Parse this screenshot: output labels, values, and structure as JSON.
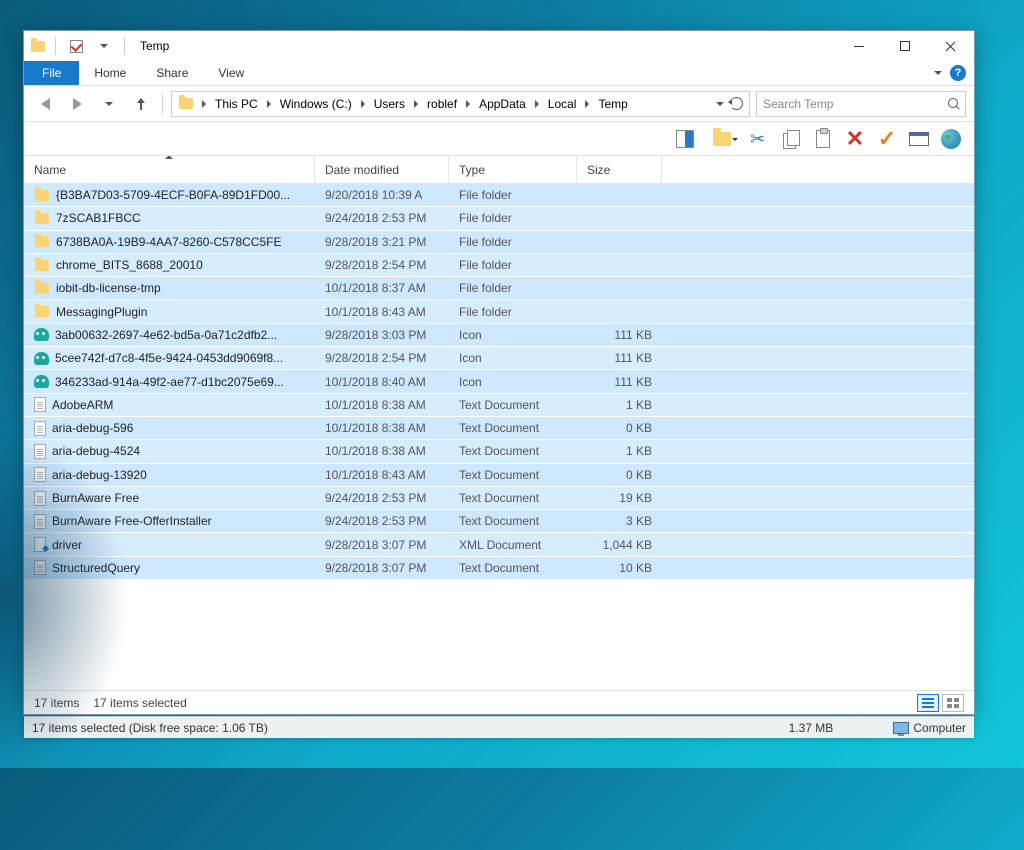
{
  "window": {
    "title": "Temp"
  },
  "ribbon": {
    "file": "File",
    "tabs": [
      "Home",
      "Share",
      "View"
    ]
  },
  "breadcrumb": {
    "segments": [
      "This PC",
      "Windows (C:)",
      "Users",
      "roblef",
      "AppData",
      "Local",
      "Temp"
    ]
  },
  "search": {
    "placeholder": "Search Temp"
  },
  "columns": {
    "name": "Name",
    "date": "Date modified",
    "type": "Type",
    "size": "Size"
  },
  "files": [
    {
      "name": "{B3BA7D03-5709-4ECF-B0FA-89D1FD00...",
      "date": "9/20/2018 10:39 A",
      "type": "File folder",
      "size": "",
      "icon": "folder"
    },
    {
      "name": "7zSCAB1FBCC",
      "date": "9/24/2018 2:53 PM",
      "type": "File folder",
      "size": "",
      "icon": "folder"
    },
    {
      "name": "6738BA0A-19B9-4AA7-8260-C578CC5FE",
      "date": "9/28/2018 3:21 PM",
      "type": "File folder",
      "size": "",
      "icon": "folder"
    },
    {
      "name": "chrome_BITS_8688_20010",
      "date": "9/28/2018 2:54 PM",
      "type": "File folder",
      "size": "",
      "icon": "folder"
    },
    {
      "name": "iobit-db-license-tmp",
      "date": "10/1/2018 8:37 AM",
      "type": "File folder",
      "size": "",
      "icon": "folder"
    },
    {
      "name": "MessagingPlugin",
      "date": "10/1/2018 8:43 AM",
      "type": "File folder",
      "size": "",
      "icon": "folder"
    },
    {
      "name": "3ab00632-2697-4e62-bd5a-0a71c2dfb2...",
      "date": "9/28/2018 3:03 PM",
      "type": "Icon",
      "size": "111 KB",
      "icon": "face"
    },
    {
      "name": "5cee742f-d7c8-4f5e-9424-0453dd9069f8...",
      "date": "9/28/2018 2:54 PM",
      "type": "Icon",
      "size": "111 KB",
      "icon": "face"
    },
    {
      "name": "346233ad-914a-49f2-ae77-d1bc2075e69...",
      "date": "10/1/2018 8:40 AM",
      "type": "Icon",
      "size": "111 KB",
      "icon": "face"
    },
    {
      "name": "AdobeARM",
      "date": "10/1/2018 8:38 AM",
      "type": "Text Document",
      "size": "1 KB",
      "icon": "text"
    },
    {
      "name": "aria-debug-596",
      "date": "10/1/2018 8:38 AM",
      "type": "Text Document",
      "size": "0 KB",
      "icon": "text"
    },
    {
      "name": "aria-debug-4524",
      "date": "10/1/2018 8:38 AM",
      "type": "Text Document",
      "size": "1 KB",
      "icon": "text"
    },
    {
      "name": "aria-debug-13920",
      "date": "10/1/2018 8:43 AM",
      "type": "Text Document",
      "size": "0 KB",
      "icon": "text"
    },
    {
      "name": "BurnAware Free",
      "date": "9/24/2018 2:53 PM",
      "type": "Text Document",
      "size": "19 KB",
      "icon": "text"
    },
    {
      "name": "BurnAware Free-OfferInstaller",
      "date": "9/24/2018 2:53 PM",
      "type": "Text Document",
      "size": "3 KB",
      "icon": "text"
    },
    {
      "name": "driver",
      "date": "9/28/2018 3:07 PM",
      "type": "XML Document",
      "size": "1,044 KB",
      "icon": "xml"
    },
    {
      "name": "StructuredQuery",
      "date": "9/28/2018 3:07 PM",
      "type": "Text Document",
      "size": "10 KB",
      "icon": "text"
    }
  ],
  "status_inner": {
    "count": "17 items",
    "selected": "17 items selected"
  },
  "status_outer": {
    "left": "17 items selected (Disk free space: 1.06 TB)",
    "size": "1.37 MB",
    "location": "Computer"
  }
}
